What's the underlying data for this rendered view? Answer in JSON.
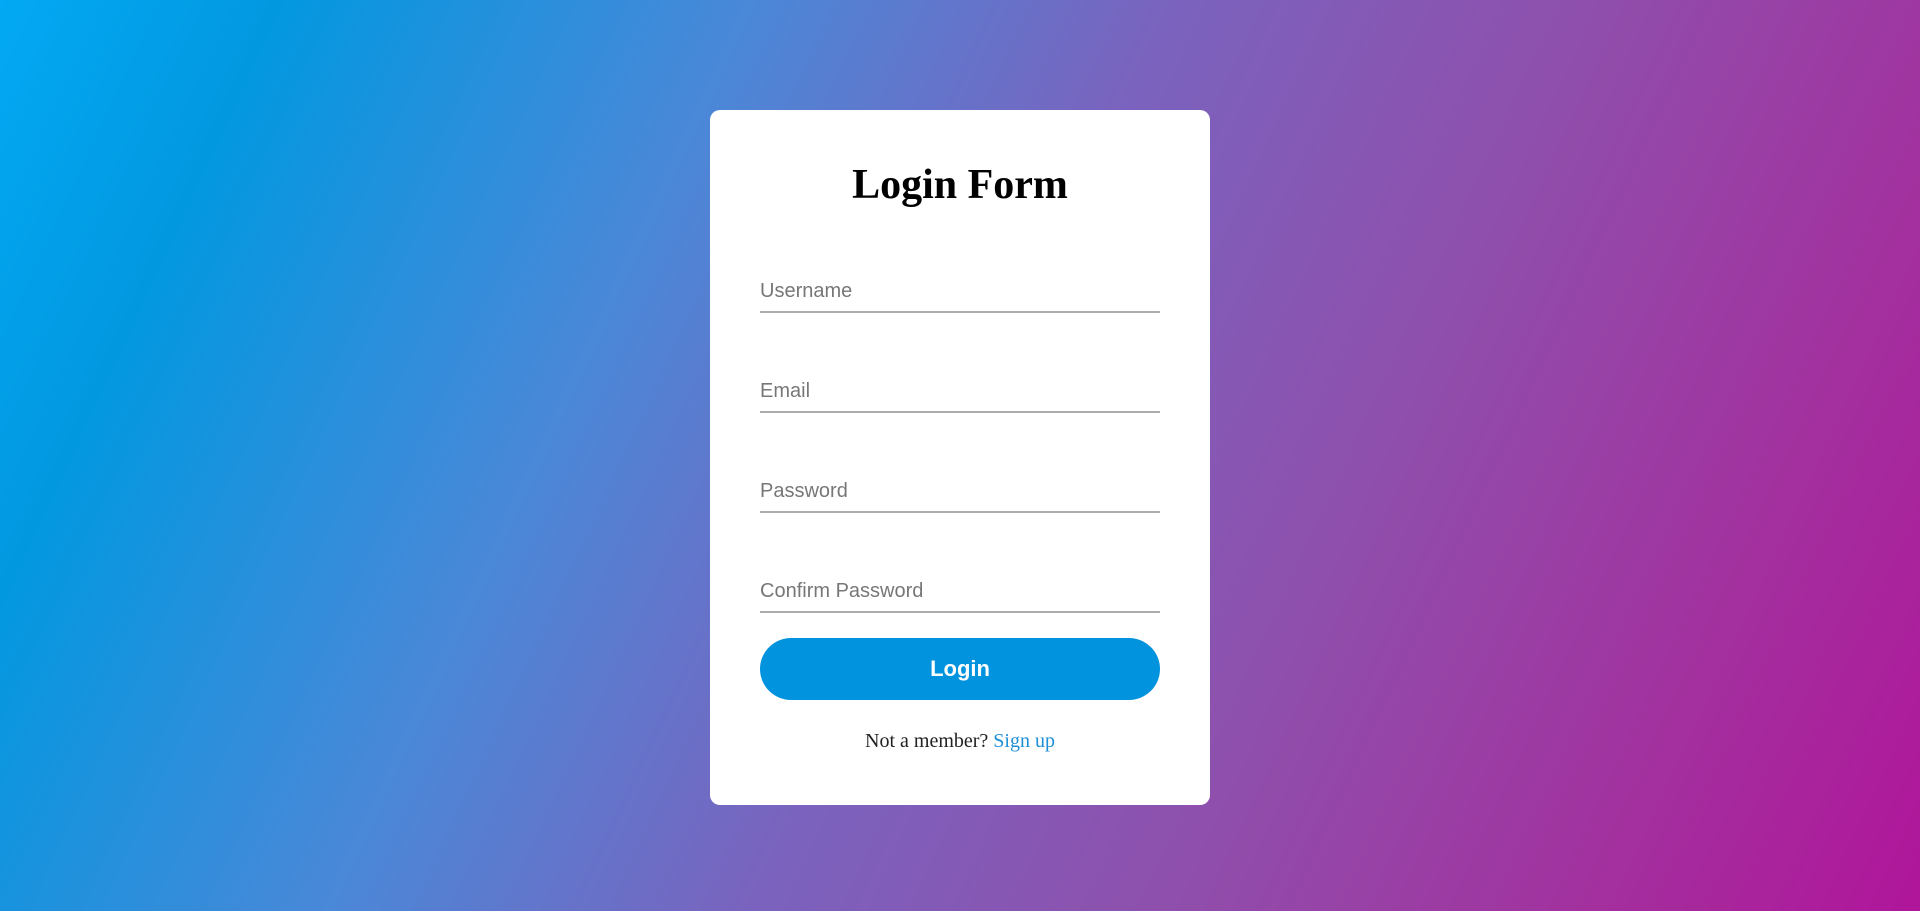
{
  "form": {
    "title": "Login Form",
    "fields": [
      {
        "placeholder": "Username",
        "value": ""
      },
      {
        "placeholder": "Email",
        "value": ""
      },
      {
        "placeholder": "Password",
        "value": ""
      },
      {
        "placeholder": "Confirm Password",
        "value": ""
      }
    ],
    "login_label": "Login",
    "signup_prompt": "Not a member?",
    "signup_link": "Sign up"
  },
  "colors": {
    "accent": "#0293de",
    "link": "#1d8fd6",
    "card": "#ffffff"
  }
}
